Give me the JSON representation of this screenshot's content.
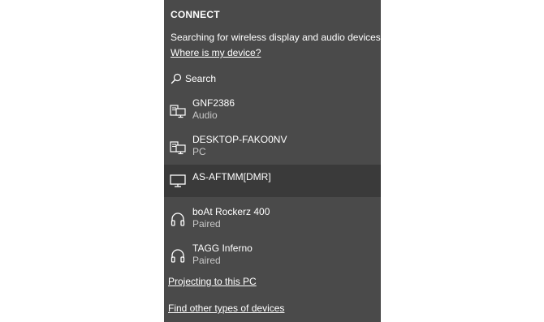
{
  "header": {
    "title": "CONNECT",
    "status": "Searching for wireless display and audio devices",
    "help_link": "Where is my device?"
  },
  "search": {
    "label": "Search",
    "icon": "search-icon"
  },
  "devices": [
    {
      "name": "GNF2386",
      "type": "Audio",
      "icon": "network-device-icon",
      "selected": false
    },
    {
      "name": "DESKTOP-FAKO0NV",
      "type": "PC",
      "icon": "network-device-icon",
      "selected": false
    },
    {
      "name": "AS-AFTMM[DMR]",
      "type": "",
      "icon": "monitor-icon",
      "selected": true
    },
    {
      "name": "boAt Rockerz 400",
      "type": "Paired",
      "icon": "headphones-icon",
      "selected": false
    },
    {
      "name": "TAGG Inferno",
      "type": "Paired",
      "icon": "headphones-icon",
      "selected": false
    }
  ],
  "footer": {
    "projecting_link": "Projecting to this PC",
    "other_devices_link": "Find other types of devices"
  },
  "colors": {
    "panel_background": "#4a4a4a",
    "selected_row": "#3a3a3a",
    "text": "#ffffff",
    "secondary_text": "#c8c8c8",
    "page_background": "#ffffff"
  }
}
